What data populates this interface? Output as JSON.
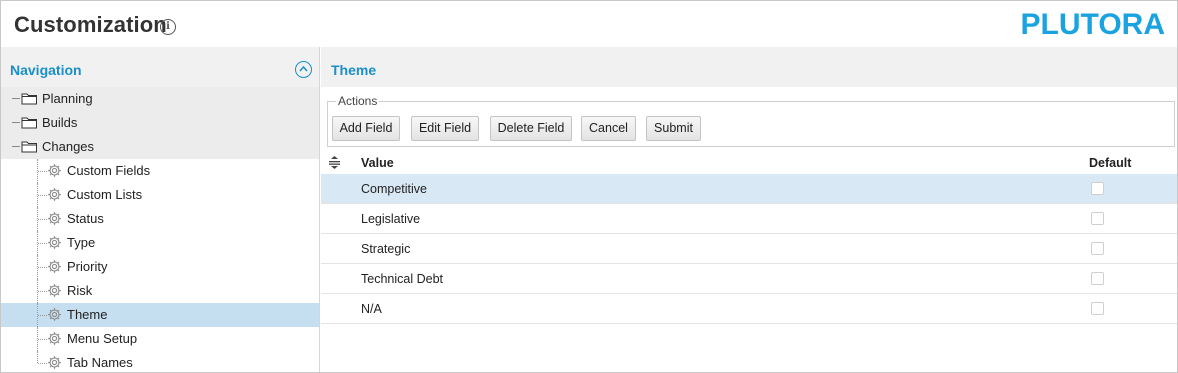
{
  "header": {
    "title": "Customization",
    "info_glyph": "i",
    "logo_text": "PLUTORA",
    "logo_color": "#1aa3e0"
  },
  "nav": {
    "title": "Navigation",
    "items": [
      {
        "label": "Planning",
        "type": "folder",
        "icon": "folder-icon"
      },
      {
        "label": "Builds",
        "type": "folder",
        "icon": "folder-icon"
      },
      {
        "label": "Changes",
        "type": "folder-open",
        "icon": "folder-open-icon"
      },
      {
        "label": "Custom Fields",
        "type": "leaf",
        "icon": "gear-icon"
      },
      {
        "label": "Custom Lists",
        "type": "leaf",
        "icon": "gear-icon"
      },
      {
        "label": "Status",
        "type": "leaf",
        "icon": "gear-icon"
      },
      {
        "label": "Type",
        "type": "leaf",
        "icon": "gear-icon"
      },
      {
        "label": "Priority",
        "type": "leaf",
        "icon": "gear-icon"
      },
      {
        "label": "Risk",
        "type": "leaf",
        "icon": "gear-icon"
      },
      {
        "label": "Theme",
        "type": "leaf",
        "icon": "gear-icon",
        "selected": true
      },
      {
        "label": "Menu Setup",
        "type": "leaf",
        "icon": "gear-icon"
      },
      {
        "label": "Tab Names",
        "type": "leaf",
        "icon": "gear-icon"
      }
    ]
  },
  "main": {
    "title": "Theme",
    "actions_label": "Actions",
    "buttons": [
      "Add Field",
      "Edit Field",
      "Delete Field",
      "Cancel",
      "Submit"
    ],
    "columns": {
      "value": "Value",
      "default": "Default"
    },
    "rows": [
      {
        "value": "Competitive",
        "default": false,
        "selected": true
      },
      {
        "value": "Legislative",
        "default": false
      },
      {
        "value": "Strategic",
        "default": false
      },
      {
        "value": "Technical Debt",
        "default": false
      },
      {
        "value": "N/A",
        "default": false
      }
    ]
  },
  "colors": {
    "accent": "#1a8fc9",
    "selected_nav": "#c5dff1",
    "selected_row": "#d9e8f5"
  }
}
